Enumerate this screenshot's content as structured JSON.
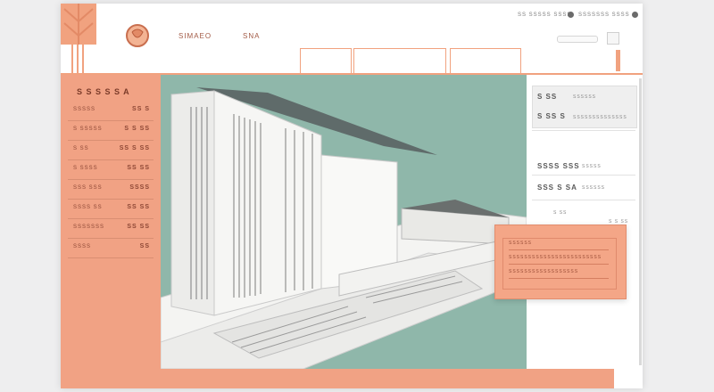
{
  "topbar": {
    "nav": [
      "SIMAEO",
      "SNA"
    ],
    "right_items": [
      "SS SSSSS SSSS",
      "SSSSSSS SSSS"
    ]
  },
  "sidebar": {
    "heading": "S S S S S A",
    "rows": [
      {
        "label": "SSSSS",
        "value": "SS S"
      },
      {
        "label": "S SSSSS",
        "value": "S S SS"
      },
      {
        "label": "S SS",
        "value": "SS S SS"
      },
      {
        "label": "S SSSS",
        "value": "SS SS"
      },
      {
        "label": "SSS SSS",
        "value": "SSSS"
      },
      {
        "label": "SSSS SS",
        "value": "SS SS"
      },
      {
        "label": "SSSSSSS",
        "value": "SS SS"
      },
      {
        "label": "SSSS",
        "value": "SS"
      }
    ]
  },
  "right_panel": {
    "items": [
      "S SS",
      "S SS S",
      "SSSS SSS",
      "SSS S SA"
    ],
    "small": [
      "SSSSSS",
      "SSSSSSSSSSSSSS",
      "SSSSS",
      "SSSSSS"
    ],
    "footer": [
      "S SS",
      "S S SS"
    ]
  },
  "popup": {
    "rows": [
      "SSSSSS",
      "SSSSSSSSSSSSSSSSSSSSSSSS",
      "SSSSSSSSSSSSSSSSSS"
    ]
  },
  "colors": {
    "accent": "#f1a284",
    "canvas": "#8fb7aa",
    "window": "#ffffff"
  }
}
